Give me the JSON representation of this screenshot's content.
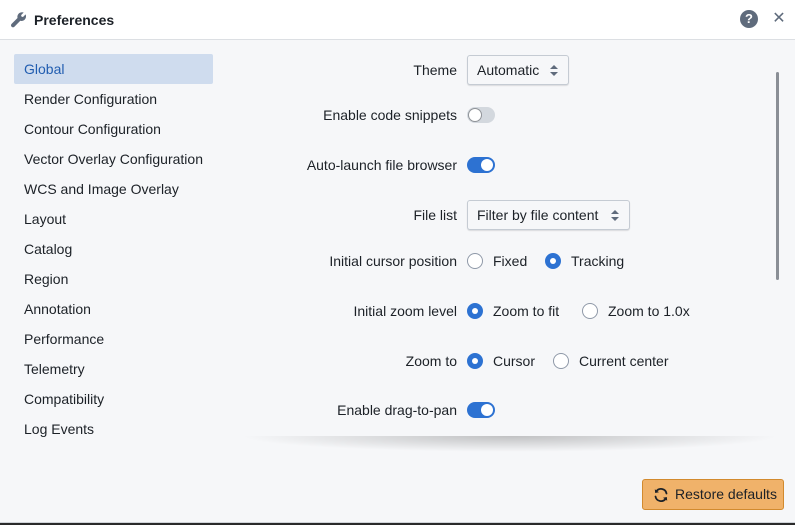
{
  "dialog": {
    "title": "Preferences",
    "help_icon": "help-icon",
    "close_icon": "close-icon",
    "title_icon": "wrench-icon"
  },
  "sidebar": {
    "items": [
      {
        "label": "Global",
        "active": true
      },
      {
        "label": "Render Configuration"
      },
      {
        "label": "Contour Configuration"
      },
      {
        "label": "Vector Overlay Configuration"
      },
      {
        "label": "WCS and Image Overlay"
      },
      {
        "label": "Layout"
      },
      {
        "label": "Catalog"
      },
      {
        "label": "Region"
      },
      {
        "label": "Annotation"
      },
      {
        "label": "Performance"
      },
      {
        "label": "Telemetry"
      },
      {
        "label": "Compatibility"
      },
      {
        "label": "Log Events"
      }
    ]
  },
  "settings": {
    "theme": {
      "label": "Theme",
      "value": "Automatic"
    },
    "code_snippets": {
      "label": "Enable code snippets",
      "enabled": false
    },
    "auto_launch": {
      "label": "Auto-launch file browser",
      "enabled": true
    },
    "file_list": {
      "label": "File list",
      "value": "Filter by file content"
    },
    "cursor_position": {
      "label": "Initial cursor position",
      "options": [
        "Fixed",
        "Tracking"
      ],
      "selected": "Tracking"
    },
    "zoom_level": {
      "label": "Initial zoom level",
      "options": [
        "Zoom to fit",
        "Zoom to 1.0x"
      ],
      "selected": "Zoom to fit"
    },
    "zoom_to": {
      "label": "Zoom to",
      "options": [
        "Cursor",
        "Current center"
      ],
      "selected": "Cursor"
    },
    "drag_to_pan": {
      "label": "Enable drag-to-pan",
      "enabled": true
    }
  },
  "footer": {
    "restore_label": "Restore defaults",
    "restore_icon": "refresh-icon"
  },
  "colors": {
    "accent": "#2d72d2",
    "active_item_bg": "#cfdcee",
    "warning_button": "#f0b26a"
  }
}
